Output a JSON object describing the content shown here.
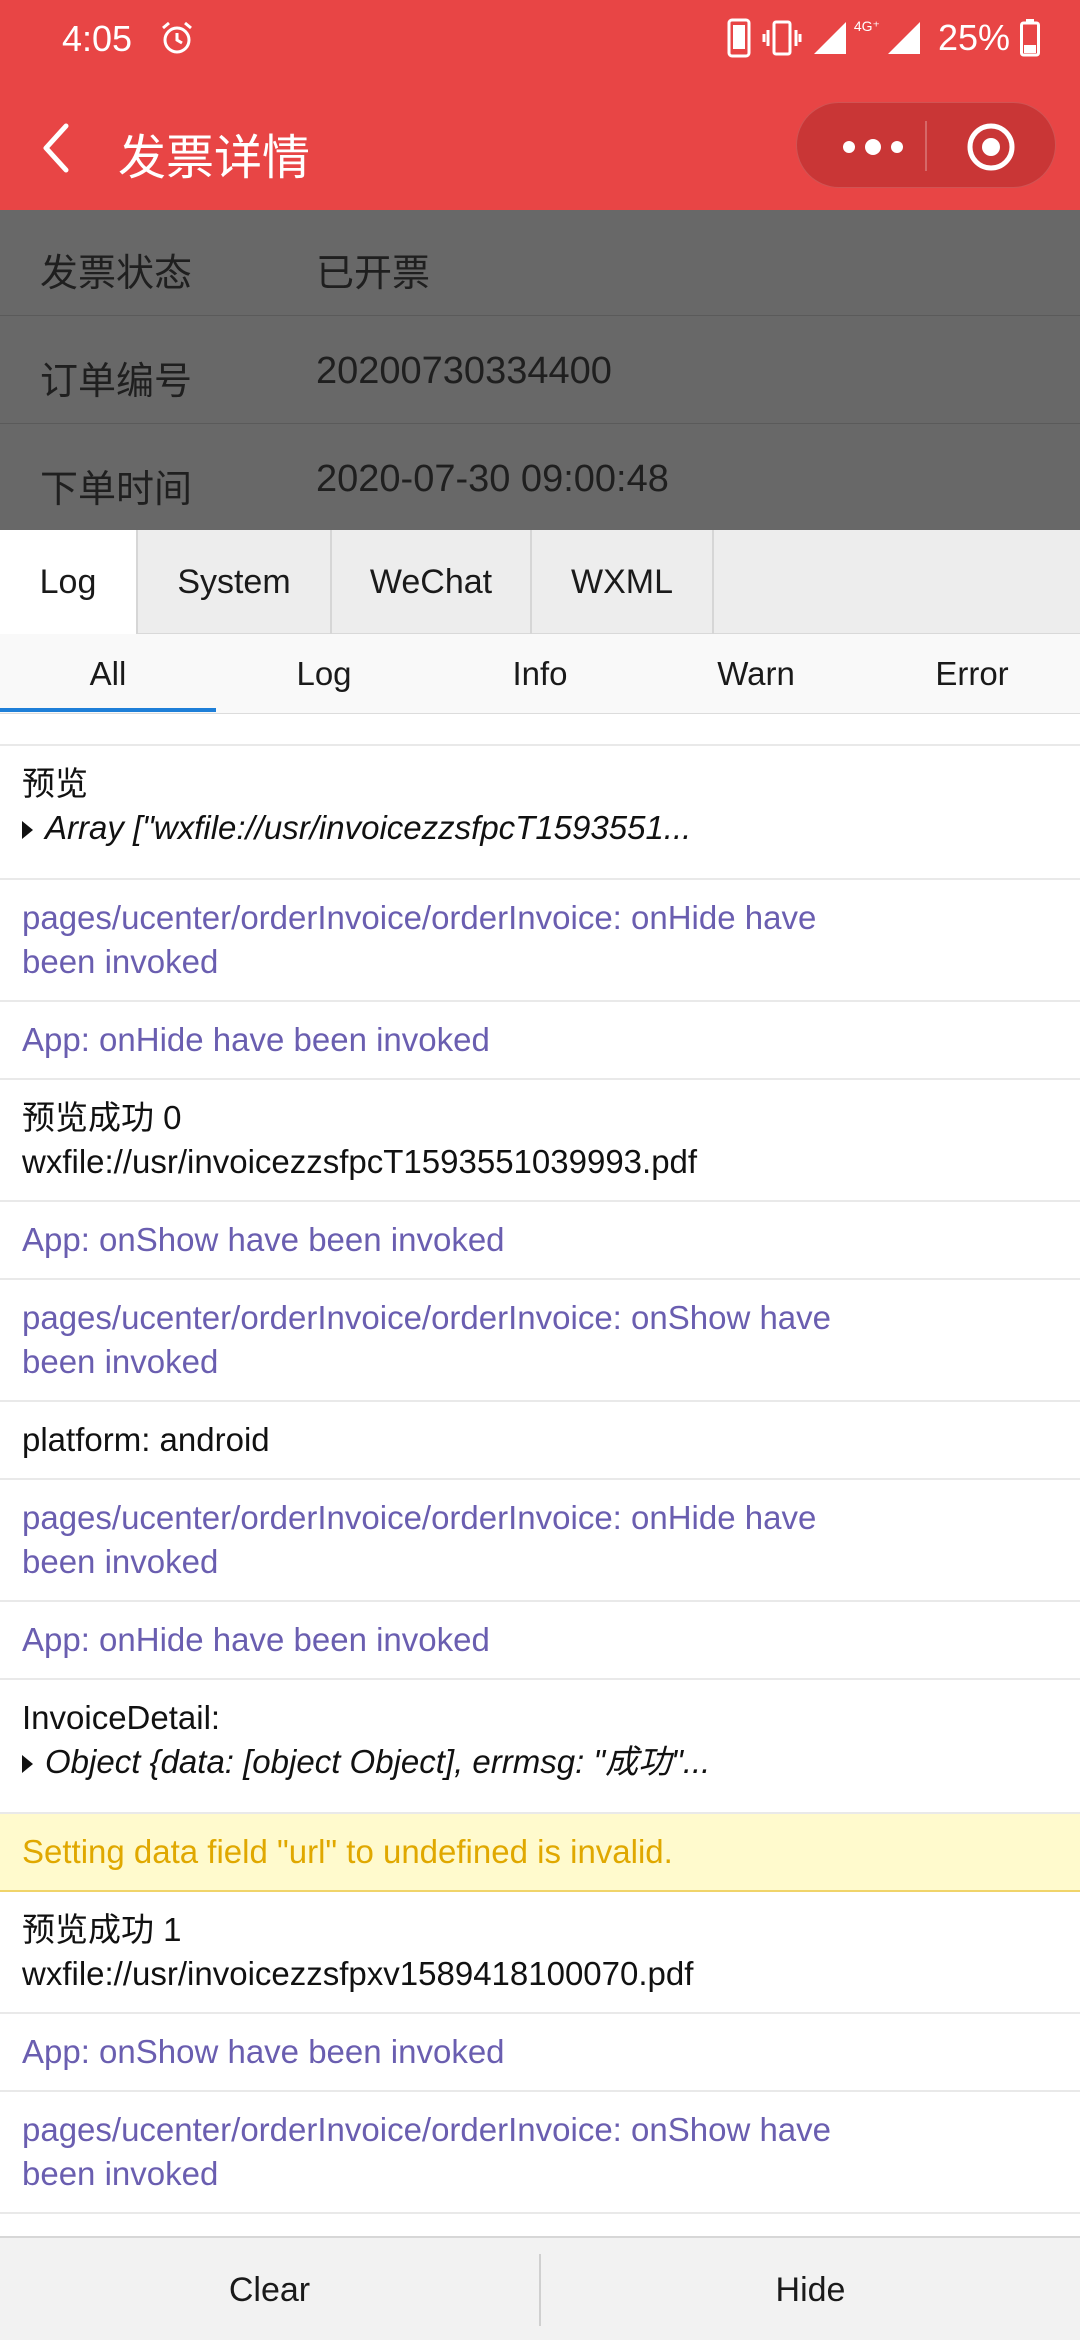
{
  "status_bar": {
    "time": "4:05",
    "battery": "25%",
    "network": "4G⁺"
  },
  "nav": {
    "title": "发票详情"
  },
  "invoice": {
    "rows": [
      {
        "label": "发票状态",
        "value": "已开票"
      },
      {
        "label": "订单编号",
        "value": "20200730334400"
      },
      {
        "label": "下单时间",
        "value": "2020-07-30 09:00:48"
      }
    ]
  },
  "tabs": [
    "Log",
    "System",
    "WeChat",
    "WXML"
  ],
  "subtabs": [
    "All",
    "Log",
    "Info",
    "Warn",
    "Error"
  ],
  "logs": [
    {
      "line1": "预览",
      "line2": "Array [\"wxfile://usr/invoicezzsfpcT1593551..."
    },
    {
      "line1": "pages/ucenter/orderInvoice/orderInvoice: onHide have",
      "line2": "been invoked"
    },
    {
      "line1": "App: onHide have been invoked"
    },
    {
      "line1": "预览成功 0",
      "line2": "wxfile://usr/invoicezzsfpcT1593551039993.pdf"
    },
    {
      "line1": "App: onShow have been invoked"
    },
    {
      "line1": "pages/ucenter/orderInvoice/orderInvoice: onShow have",
      "line2": "been invoked"
    },
    {
      "line1": "platform: android"
    },
    {
      "line1": "pages/ucenter/orderInvoice/orderInvoice: onHide have",
      "line2": "been invoked"
    },
    {
      "line1": "App: onHide have been invoked"
    },
    {
      "line1": "InvoiceDetail:",
      "line2": "Object {data: [object Object], errmsg: \"成功\"..."
    },
    {
      "line1": "Setting data field \"url\" to undefined is invalid."
    },
    {
      "line1": "预览成功 1",
      "line2": "wxfile://usr/invoicezzsfpxv1589418100070.pdf"
    },
    {
      "line1": "App: onShow have been invoked"
    },
    {
      "line1": "pages/ucenter/orderInvoice/orderInvoice: onShow have",
      "line2": "been invoked"
    }
  ],
  "bottom": {
    "clear": "Clear",
    "hide": "Hide"
  },
  "colors": {
    "brand": "#e84545",
    "system_log": "#6a5eb0",
    "warn_text": "#e0a800",
    "warn_bg": "#fffacd",
    "active_underline": "#1e7fd8"
  }
}
